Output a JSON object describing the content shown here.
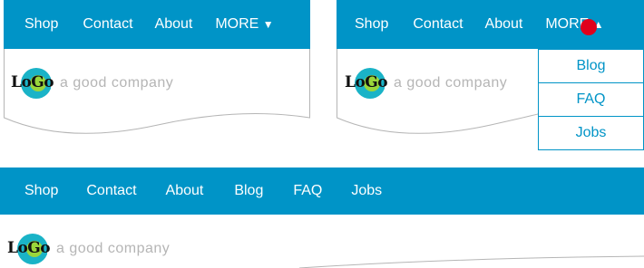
{
  "colors": {
    "nav_bg": "#0094c7",
    "nav_text": "#ffffff",
    "tagline": "#b5b5b5",
    "cursor": "#e0001b"
  },
  "logo": {
    "text": "LoGo",
    "tagline": "a good company"
  },
  "panel_collapsed": {
    "nav": [
      "Shop",
      "Contact",
      "About"
    ],
    "more_label": "MORE",
    "more_arrow": "▼"
  },
  "panel_open": {
    "nav": [
      "Shop",
      "Contact",
      "About"
    ],
    "more_label": "MORE",
    "more_arrow": "▲",
    "dropdown": [
      "Blog",
      "FAQ",
      "Jobs"
    ]
  },
  "panel_wide": {
    "nav": [
      "Shop",
      "Contact",
      "About",
      "Blog",
      "FAQ",
      "Jobs"
    ]
  }
}
